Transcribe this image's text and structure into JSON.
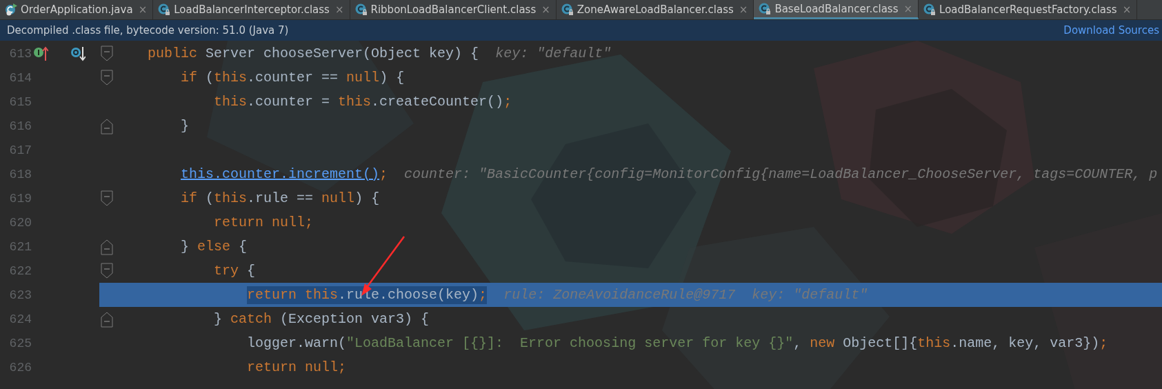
{
  "tabs": [
    {
      "label": "OrderApplication.java",
      "kind": "runnable",
      "selected": false
    },
    {
      "label": "LoadBalancerInterceptor.class",
      "kind": "class",
      "selected": false
    },
    {
      "label": "RibbonLoadBalancerClient.class",
      "kind": "class",
      "selected": false
    },
    {
      "label": "ZoneAwareLoadBalancer.class",
      "kind": "class",
      "selected": false
    },
    {
      "label": "BaseLoadBalancer.class",
      "kind": "class",
      "selected": true
    },
    {
      "label": "LoadBalancerRequestFactory.class",
      "kind": "class",
      "selected": false
    }
  ],
  "close_glyph": "×",
  "info_bar": {
    "message": "Decompiled .class file, bytecode version: 51.0 (Java 7)",
    "link": "Download Sources"
  },
  "lines": [
    {
      "number": "613",
      "selected": false,
      "fold_start": true,
      "fold_end": false,
      "implemented_marker": true,
      "overriding_marker": true,
      "tokens": [
        {
          "kind": "keyword",
          "text": "    public"
        },
        {
          "kind": "plain",
          "text": " Server chooseServer(Object key) { "
        },
        {
          "kind": "hint",
          "text": " key: \"default\""
        }
      ]
    },
    {
      "number": "614",
      "selected": false,
      "fold_start": true,
      "fold_end": false,
      "implemented_marker": false,
      "overriding_marker": false,
      "tokens": [
        {
          "kind": "keyword",
          "text": "        if"
        },
        {
          "kind": "plain",
          "text": " ("
        },
        {
          "kind": "keyword",
          "text": "this"
        },
        {
          "kind": "plain",
          "text": ".counter == "
        },
        {
          "kind": "keyword",
          "text": "null"
        },
        {
          "kind": "plain",
          "text": ") {"
        }
      ]
    },
    {
      "number": "615",
      "selected": false,
      "fold_start": false,
      "fold_end": false,
      "implemented_marker": false,
      "overriding_marker": false,
      "tokens": [
        {
          "kind": "keyword",
          "text": "            this"
        },
        {
          "kind": "plain",
          "text": ".counter = "
        },
        {
          "kind": "keyword",
          "text": "this"
        },
        {
          "kind": "plain",
          "text": ".createCounter()"
        },
        {
          "kind": "keyword",
          "text": ";"
        }
      ]
    },
    {
      "number": "616",
      "selected": false,
      "fold_start": false,
      "fold_end": true,
      "implemented_marker": false,
      "overriding_marker": false,
      "tokens": [
        {
          "kind": "plain",
          "text": "        }"
        }
      ]
    },
    {
      "number": "617",
      "selected": false,
      "fold_start": false,
      "fold_end": false,
      "implemented_marker": false,
      "overriding_marker": false
    },
    {
      "number": "618",
      "selected": false,
      "fold_start": false,
      "fold_end": false,
      "implemented_marker": false,
      "overriding_marker": false,
      "tokens": [
        {
          "kind": "link",
          "text": "        this.counter.increment()"
        },
        {
          "kind": "keyword",
          "text": ";"
        },
        {
          "kind": "hint",
          "text": "  counter: \"BasicCounter{config=MonitorConfig{name=LoadBalancer_ChooseServer, tags=COUNTER, p"
        }
      ]
    },
    {
      "number": "619",
      "selected": false,
      "fold_start": true,
      "fold_end": false,
      "implemented_marker": false,
      "overriding_marker": false,
      "tokens": [
        {
          "kind": "keyword",
          "text": "        if"
        },
        {
          "kind": "plain",
          "text": " ("
        },
        {
          "kind": "keyword",
          "text": "this"
        },
        {
          "kind": "plain",
          "text": ".rule == "
        },
        {
          "kind": "keyword",
          "text": "null"
        },
        {
          "kind": "plain",
          "text": ") {"
        }
      ]
    },
    {
      "number": "620",
      "selected": false,
      "fold_start": false,
      "fold_end": false,
      "implemented_marker": false,
      "overriding_marker": false,
      "tokens": [
        {
          "kind": "keyword",
          "text": "            return null;"
        }
      ]
    },
    {
      "number": "621",
      "selected": false,
      "fold_start": false,
      "fold_end": true,
      "implemented_marker": false,
      "overriding_marker": false,
      "tokens": [
        {
          "kind": "plain",
          "text": "        } "
        },
        {
          "kind": "keyword",
          "text": "else"
        },
        {
          "kind": "plain",
          "text": " {"
        }
      ]
    },
    {
      "number": "622",
      "selected": false,
      "fold_start": true,
      "fold_end": false,
      "implemented_marker": false,
      "overriding_marker": false,
      "tokens": [
        {
          "kind": "keyword",
          "text": "            try"
        },
        {
          "kind": "plain",
          "text": " {"
        }
      ]
    },
    {
      "number": "623",
      "selected": true,
      "fold_start": false,
      "fold_end": false,
      "implemented_marker": false,
      "overriding_marker": false,
      "tokens": [
        {
          "kind": "keyword",
          "text": "                return this"
        },
        {
          "kind": "plain",
          "text": ".rule.choose(key)"
        },
        {
          "kind": "keyword",
          "text": ";"
        },
        {
          "kind": "hint",
          "text": "  rule: ZoneAvoidanceRule@9717  key: \"default\""
        }
      ]
    },
    {
      "number": "624",
      "selected": false,
      "fold_start": false,
      "fold_end": true,
      "implemented_marker": false,
      "overriding_marker": false,
      "tokens": [
        {
          "kind": "plain",
          "text": "            } "
        },
        {
          "kind": "keyword",
          "text": "catch"
        },
        {
          "kind": "plain",
          "text": " (Exception var3) {"
        }
      ]
    },
    {
      "number": "625",
      "selected": false,
      "fold_start": false,
      "fold_end": false,
      "implemented_marker": false,
      "overriding_marker": false,
      "tokens": [
        {
          "kind": "plain",
          "text": "                logger.warn("
        },
        {
          "kind": "string",
          "text": "\"LoadBalancer [{}]:  Error choosing server for key {}\""
        },
        {
          "kind": "plain",
          "text": ", "
        },
        {
          "kind": "keyword",
          "text": "new"
        },
        {
          "kind": "plain",
          "text": " Object[]{"
        },
        {
          "kind": "keyword",
          "text": "this"
        },
        {
          "kind": "plain",
          "text": ".name, key, var3})"
        },
        {
          "kind": "keyword",
          "text": ";"
        }
      ]
    },
    {
      "number": "626",
      "selected": false,
      "fold_start": false,
      "fold_end": false,
      "implemented_marker": false,
      "overriding_marker": false,
      "tokens": [
        {
          "kind": "keyword",
          "text": "                return null;"
        }
      ]
    }
  ]
}
